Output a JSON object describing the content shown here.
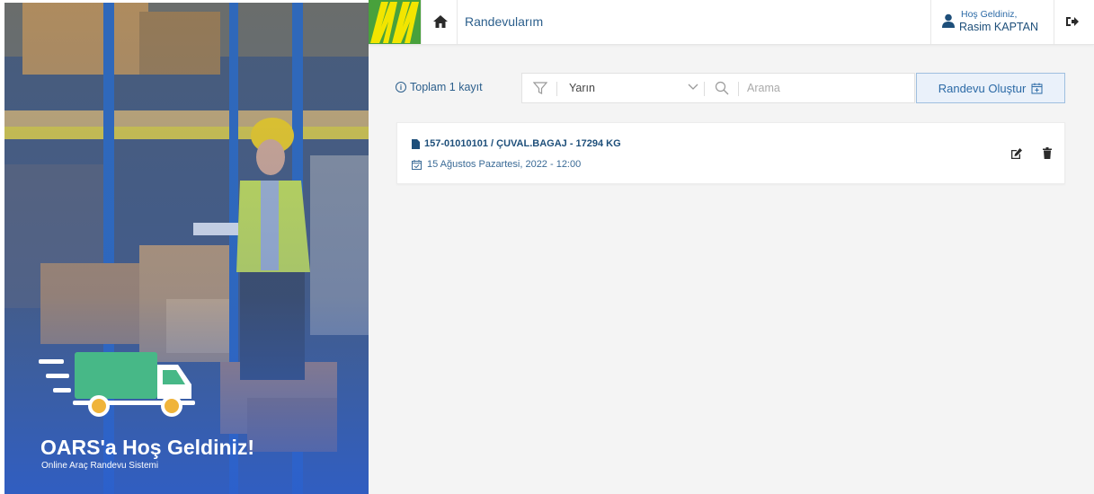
{
  "hero": {
    "title": "OARS'a Hoş Geldiniz!",
    "subtitle": "Online Araç Randevu Sistemi"
  },
  "header": {
    "logo": "brand-logo",
    "home_icon": "home-icon",
    "title": "Randevularım",
    "welcome": "Hoş Geldiniz,",
    "user_name": "Rasim KAPTAN",
    "user_icon": "user-icon",
    "logout_icon": "logout-icon"
  },
  "toolbar": {
    "total_label": "Toplam 1 kayıt",
    "filter_icon": "filter-icon",
    "date_filter": {
      "selected": "Yarın"
    },
    "search": {
      "placeholder": "Arama",
      "value": ""
    },
    "create_button": "Randevu Oluştur"
  },
  "appointments": [
    {
      "title": "157-01010101 / ÇUVAL.BAGAJ - 17294 KG",
      "date": "15 Ağustos Pazartesi, 2022 - 12:00",
      "icons": [
        "file-icon",
        "calendar-icon",
        "edit-icon",
        "trash-icon"
      ]
    }
  ],
  "colors": {
    "brand_green": "#48a13c",
    "brand_yellow": "#f2e500",
    "primary_text": "#1e4f7a",
    "accent_blue": "#2c6aa6",
    "background": "#f4f4f4"
  }
}
